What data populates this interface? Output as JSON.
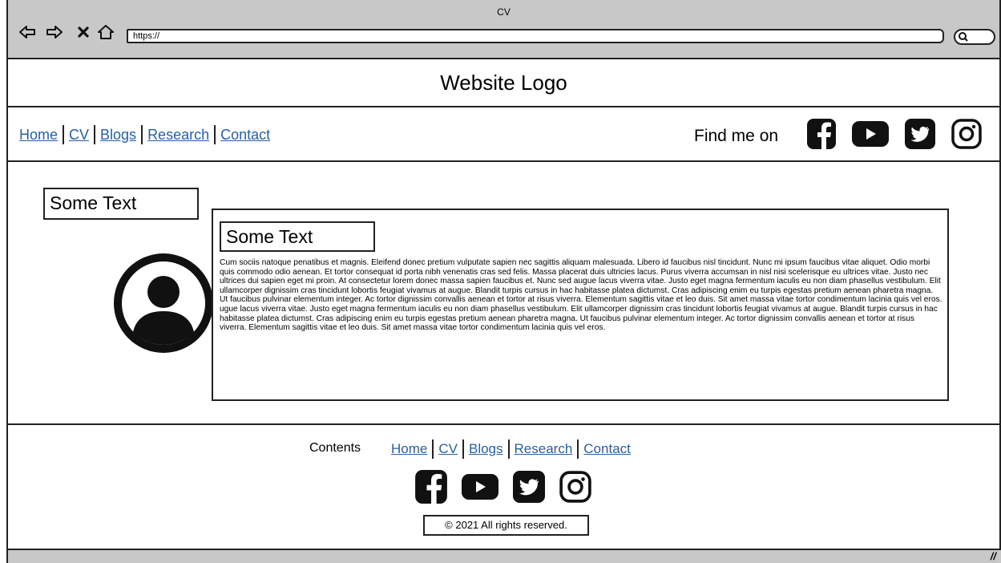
{
  "browser": {
    "title": "CV",
    "url": "https://"
  },
  "header": {
    "logo": "Website Logo",
    "nav": [
      "Home",
      "CV",
      "Blogs",
      "Research",
      "Contact"
    ],
    "find_me": "Find me on"
  },
  "social_icons": [
    "facebook-icon",
    "youtube-icon",
    "twitter-icon",
    "instagram-icon"
  ],
  "main": {
    "side_label": "Some Text",
    "content_title": "Some Text",
    "content_body": "Cum sociis natoque penatibus et magnis. Eleifend donec pretium vulputate sapien nec sagittis aliquam malesuada. Libero id faucibus nisl tincidunt. Nunc mi ipsum faucibus vitae aliquet. Odio morbi quis commodo odio aenean. Et tortor consequat id porta nibh venenatis cras sed felis. Massa placerat duis ultricies lacus. Purus viverra accumsan in nisl nisi scelerisque eu ultrices vitae. Justo nec ultrices dui sapien eget mi proin. At consectetur lorem donec massa sapien faucibus et. Nunc sed augue lacus viverra vitae. Justo eget magna fermentum iaculis eu non diam phasellus vestibulum. Elit ullamcorper dignissim cras tincidunt lobortis feugiat vivamus at augue. Blandit turpis cursus in hac habitasse platea dictumst. Cras adipiscing enim eu turpis egestas pretium aenean pharetra magna. Ut faucibus pulvinar elementum integer. Ac tortor dignissim convallis aenean et tortor at risus viverra. Elementum sagittis vitae et leo duis. Sit amet massa vitae tortor condimentum lacinia quis vel eros. ugue lacus viverra vitae. Justo eget magna fermentum iaculis eu non diam phasellus vestibulum. Elit ullamcorper dignissim cras tincidunt lobortis feugiat vivamus at augue. Blandit turpis cursus in hac habitasse platea dictumst. Cras adipiscing enim eu turpis egestas pretium aenean pharetra magna. Ut faucibus pulvinar elementum integer. Ac tortor dignissim convallis aenean et tortor at risus viverra. Elementum sagittis vitae et leo duis. Sit amet massa vitae tortor condimentum lacinia quis vel eros."
  },
  "footer": {
    "contents_label": "Contents",
    "nav": [
      "Home",
      "CV",
      "Blogs",
      "Research",
      "Contact"
    ],
    "copyright": "© 2021 All rights reserved."
  }
}
